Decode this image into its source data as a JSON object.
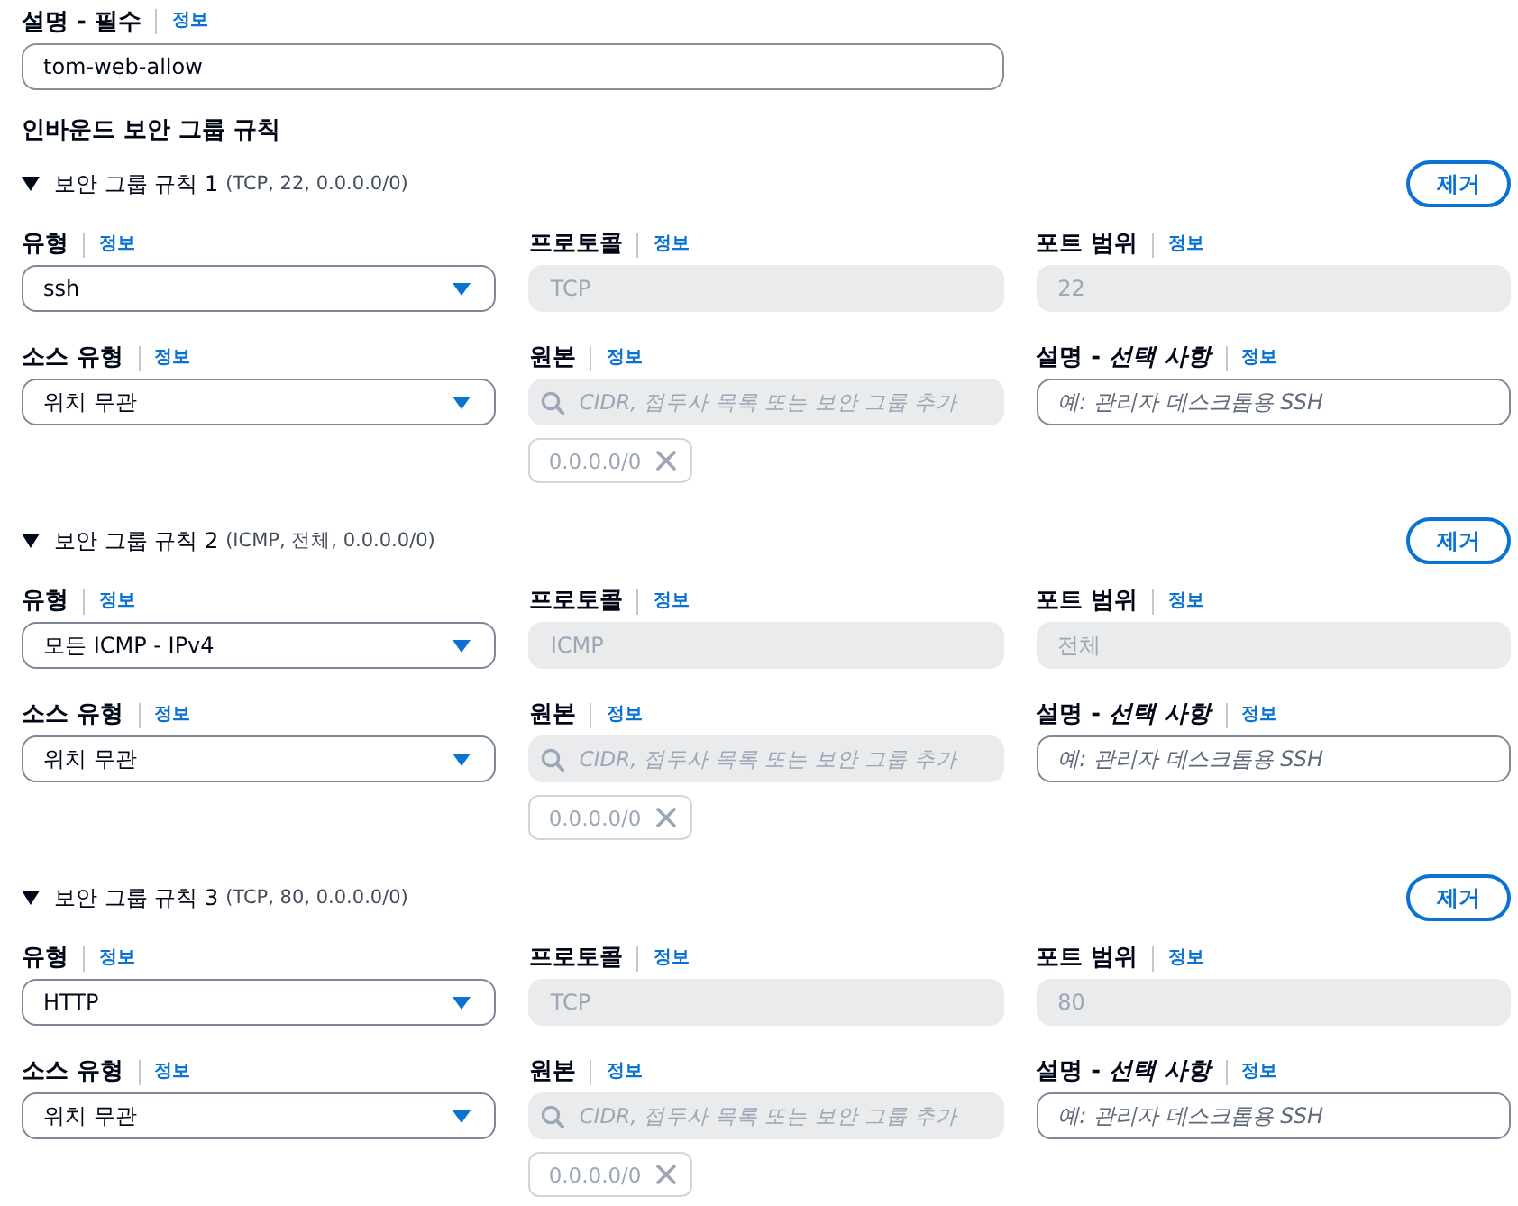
{
  "description": {
    "label": "설명 - 필수",
    "info": "정보",
    "value": "tom-web-allow"
  },
  "inbound_rules": {
    "heading": "인바운드 보안 그룹 규칙",
    "rules": [
      {
        "title": "보안 그룹 규칙 1",
        "summary": "(TCP, 22, 0.0.0.0/0)",
        "expanded": true,
        "remove_button": "제거",
        "fields": [
          {
            "kind": "select",
            "label": "유형",
            "info": "정보",
            "value": "ssh"
          },
          {
            "kind": "text",
            "label": "프로토콜",
            "info": "정보",
            "value": "TCP",
            "disabled": true
          },
          {
            "kind": "text",
            "label": "포트 범위",
            "info": "정보",
            "value": "22",
            "disabled": true
          },
          {
            "kind": "select",
            "label": "소스 유형",
            "info": "정보",
            "value": "위치 무관"
          },
          {
            "kind": "search",
            "label": "원본",
            "info": "정보",
            "placeholder": "CIDR, 접두사 목록 또는 보안 그룹 추가",
            "disabled": true,
            "tokens": [
              "0.0.0.0/0"
            ]
          },
          {
            "kind": "text",
            "label": "설명 - *선택 사항*",
            "info": "정보",
            "placeholder": "예: 관리자 데스크톱용 SSH",
            "disabled": false
          }
        ]
      },
      {
        "title": "보안 그룹 규칙 2",
        "summary": "(ICMP, 전체, 0.0.0.0/0)",
        "expanded": true,
        "remove_button": "제거",
        "fields": [
          {
            "kind": "select",
            "label": "유형",
            "info": "정보",
            "value": "모든 ICMP - IPv4"
          },
          {
            "kind": "text",
            "label": "프로토콜",
            "info": "정보",
            "value": "ICMP",
            "disabled": true
          },
          {
            "kind": "text",
            "label": "포트 범위",
            "info": "정보",
            "value": "전체",
            "disabled": true
          },
          {
            "kind": "select",
            "label": "소스 유형",
            "info": "정보",
            "value": "위치 무관"
          },
          {
            "kind": "search",
            "label": "원본",
            "info": "정보",
            "placeholder": "CIDR, 접두사 목록 또는 보안 그룹 추가",
            "disabled": true,
            "tokens": [
              "0.0.0.0/0"
            ]
          },
          {
            "kind": "text",
            "label": "설명 - *선택 사항*",
            "info": "정보",
            "placeholder": "예: 관리자 데스크톱용 SSH",
            "disabled": false
          }
        ]
      },
      {
        "title": "보안 그룹 규칙 3",
        "summary": "(TCP, 80, 0.0.0.0/0)",
        "expanded": true,
        "remove_button": "제거",
        "fields": [
          {
            "kind": "select",
            "label": "유형",
            "info": "정보",
            "value": "HTTP"
          },
          {
            "kind": "text",
            "label": "프로토콜",
            "info": "정보",
            "value": "TCP",
            "disabled": true
          },
          {
            "kind": "text",
            "label": "포트 범위",
            "info": "정보",
            "value": "80",
            "disabled": true
          },
          {
            "kind": "select",
            "label": "소스 유형",
            "info": "정보",
            "value": "위치 무관"
          },
          {
            "kind": "search",
            "label": "원본",
            "info": "정보",
            "placeholder": "CIDR, 접두사 목록 또는 보안 그룹 추가",
            "disabled": true,
            "tokens": [
              "0.0.0.0/0"
            ]
          },
          {
            "kind": "text",
            "label": "설명 - *선택 사항*",
            "info": "정보",
            "placeholder": "예: 관리자 데스크톱용 SSH",
            "disabled": false
          }
        ]
      }
    ]
  }
}
